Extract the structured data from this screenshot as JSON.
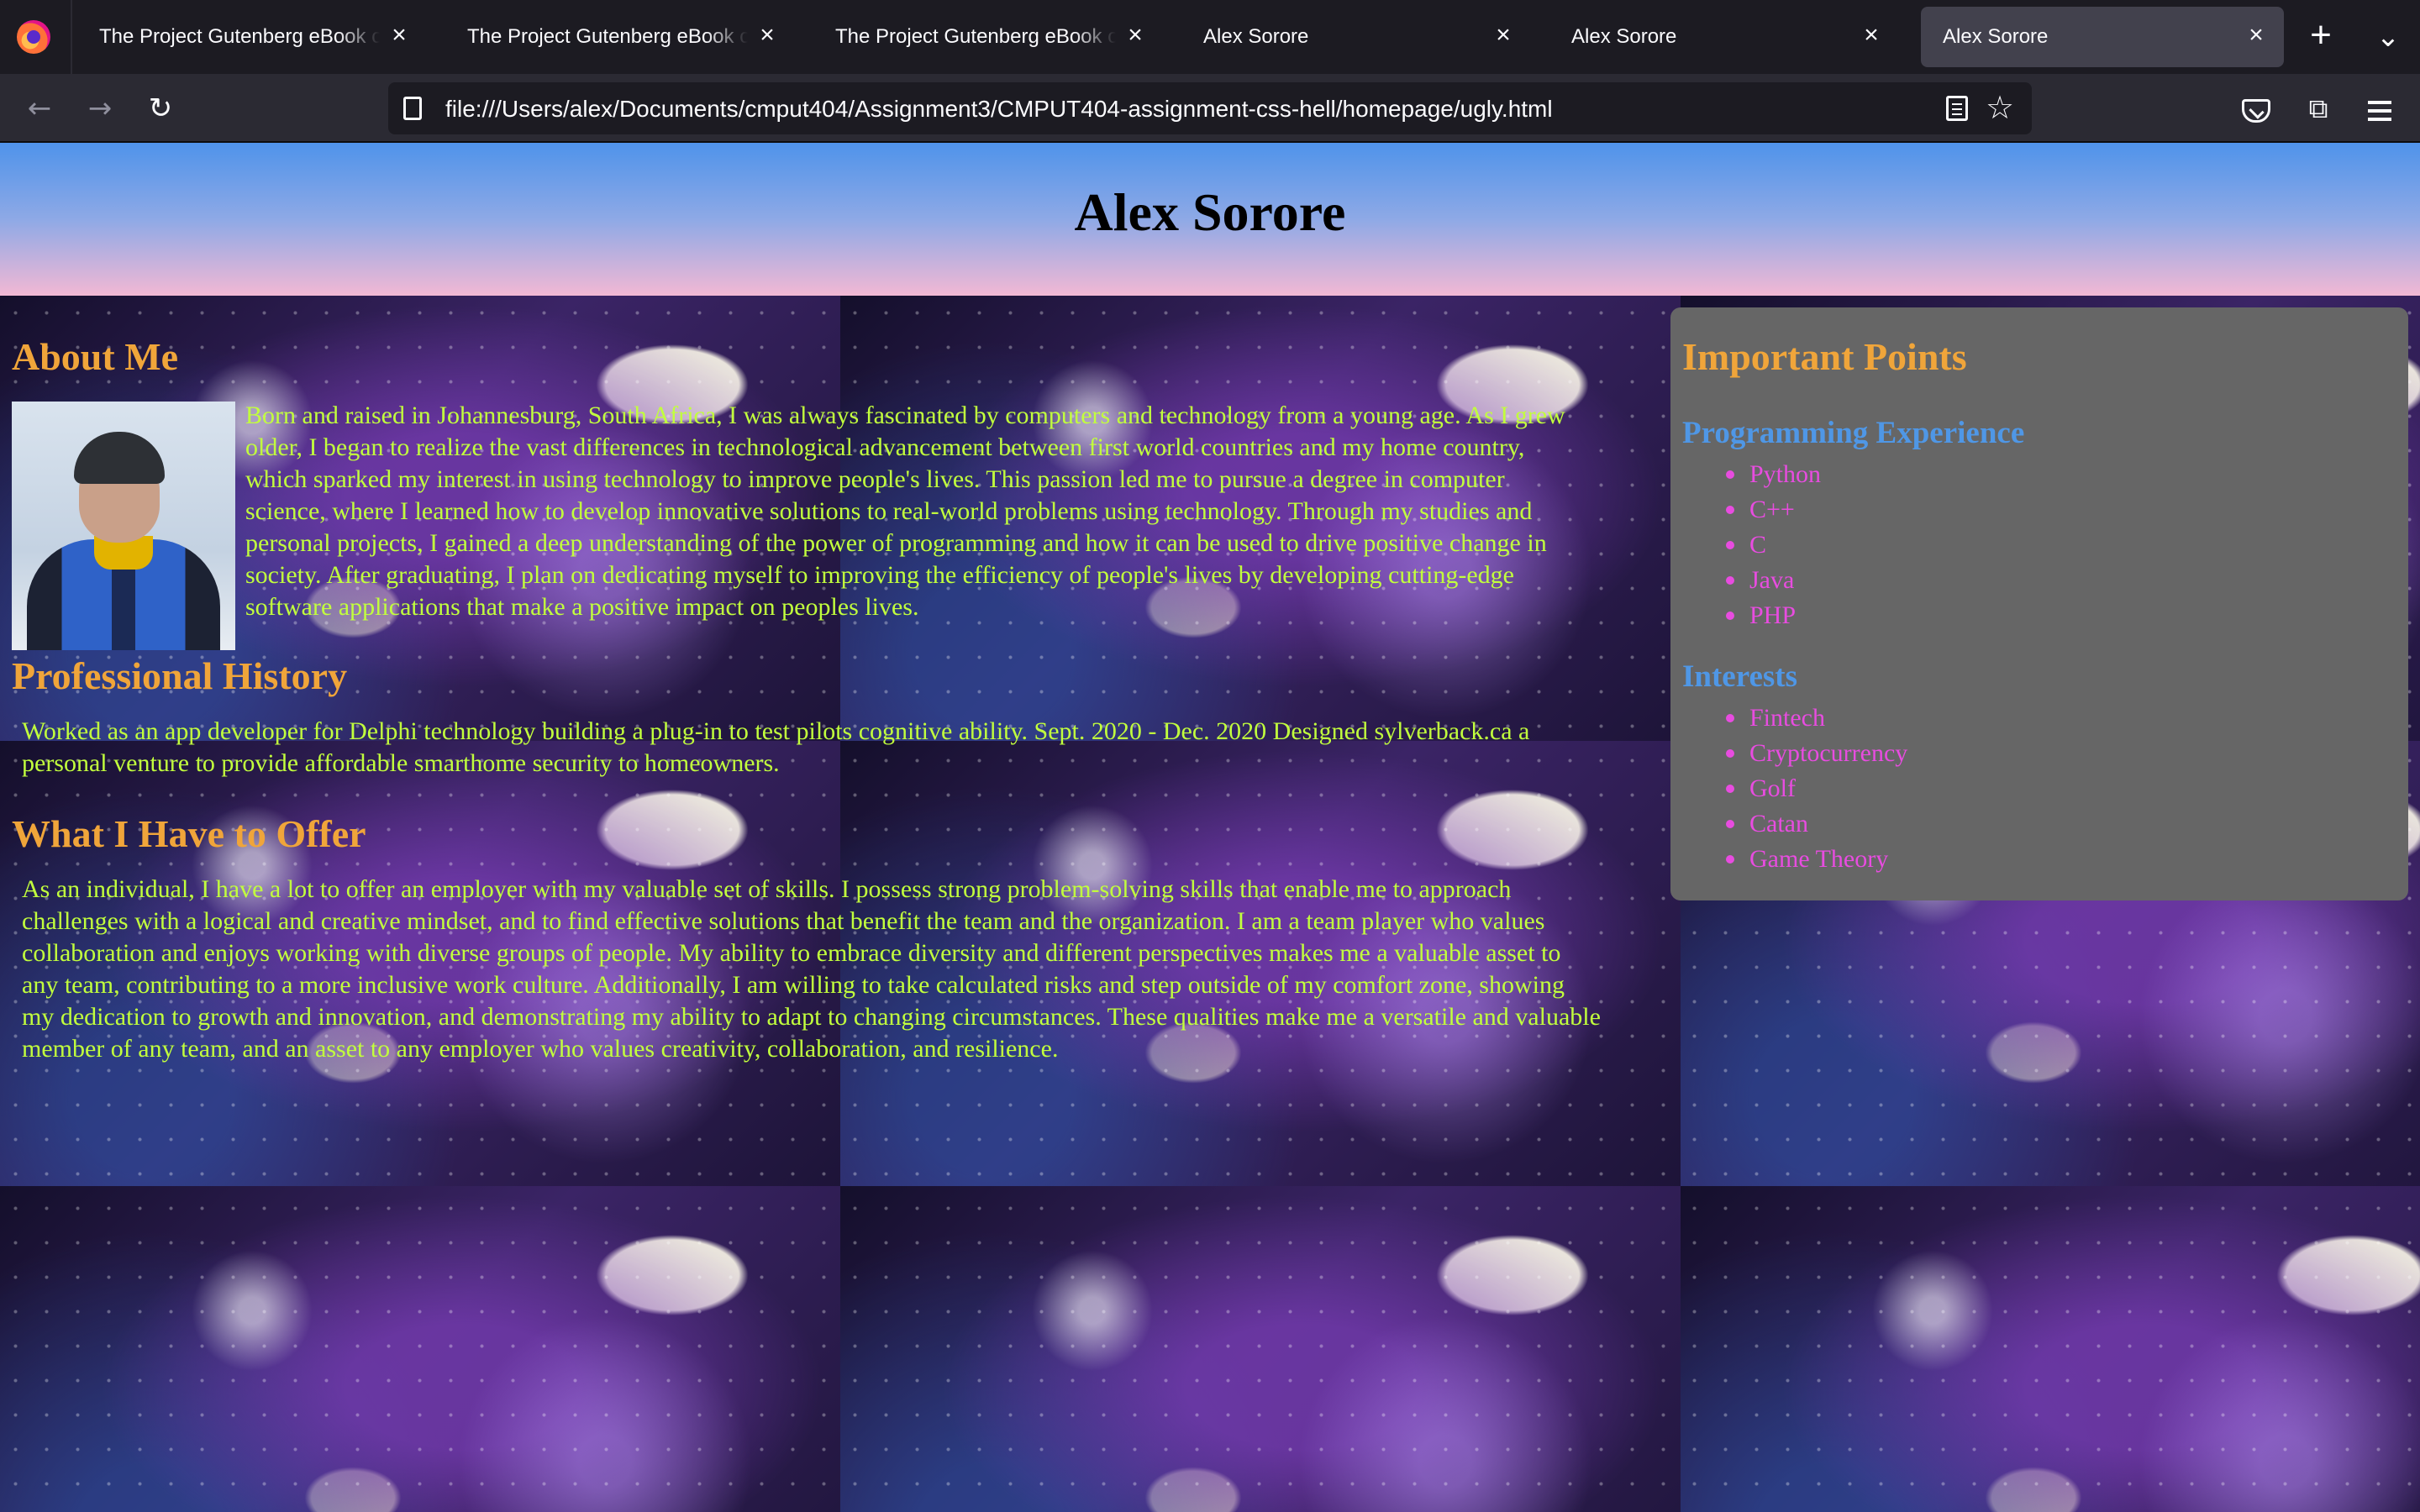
{
  "browser": {
    "tabs": [
      {
        "title": "The Project Gutenberg eBook of Al",
        "active": false
      },
      {
        "title": "The Project Gutenberg eBook of Th",
        "active": false
      },
      {
        "title": "The Project Gutenberg eBook of Fr",
        "active": false
      },
      {
        "title": "Alex Sorore",
        "active": false
      },
      {
        "title": "Alex Sorore",
        "active": false
      },
      {
        "title": "Alex Sorore",
        "active": true
      }
    ],
    "new_tab": "+",
    "tab_list": "⌄",
    "close_glyph": "×",
    "nav": {
      "back": "←",
      "forward": "→",
      "reload": "↻"
    },
    "url": "file:///Users/alex/Documents/cmput404/Assignment3/CMPUT404-assignment-css-hell/homepage/ugly.html",
    "star": "☆",
    "extensions": "⧉"
  },
  "page": {
    "title": "Alex Sorore",
    "about": {
      "heading": "About Me",
      "text": "Born and raised in Johannesburg, South Africa, I was always fascinated by computers and technology from a young age. As I grew older, I began to realize the vast differences in technological advancement between first world countries and my home country, which sparked my interest in using technology to improve people's lives. This passion led me to pursue a degree in computer science, where I learned how to develop innovative solutions to real-world problems using technology. Through my studies and personal projects, I gained a deep understanding of the power of programming and how it can be used to drive positive change in society. After graduating, I plan on dedicating myself to improving the efficiency of people's lives by developing cutting-edge software applications that make a positive impact on peoples lives."
    },
    "history": {
      "heading": "Professional History",
      "text": "Worked as an app developer for Delphi technology building a plug-in to test pilots cognitive ability. Sept. 2020 - Dec. 2020 Designed sylverback.ca a personal venture to provide affordable smarthome security to homeowners."
    },
    "offer": {
      "heading": "What I Have to Offer",
      "text": "As an individual, I have a lot to offer an employer with my valuable set of skills. I possess strong problem-solving skills that enable me to approach challenges with a logical and creative mindset, and to find effective solutions that benefit the team and the organization. I am a team player who values collaboration and enjoys working with diverse groups of people. My ability to embrace diversity and different perspectives makes me a valuable asset to any team, contributing to a more inclusive work culture. Additionally, I am willing to take calculated risks and step outside of my comfort zone, showing my dedication to growth and innovation, and demonstrating my ability to adapt to changing circumstances. These qualities make me a versatile and valuable member of any team, and an asset to any employer who values creativity, collaboration, and resilience."
    },
    "sidebar": {
      "heading": "Important Points",
      "programming": {
        "heading": "Programming Experience",
        "items": [
          "Python",
          "C++",
          "C",
          "Java",
          "PHP"
        ]
      },
      "interests": {
        "heading": "Interests",
        "items": [
          "Fintech",
          "Cryptocurrency",
          "Golf",
          "Catan",
          "Game Theory"
        ]
      }
    }
  },
  "colors": {
    "heading": "#f0a53a",
    "body_text": "#c2ff3d",
    "subheading": "#4f97e6",
    "list_text": "#e84ce0",
    "sidebar_bg": "#666666"
  }
}
